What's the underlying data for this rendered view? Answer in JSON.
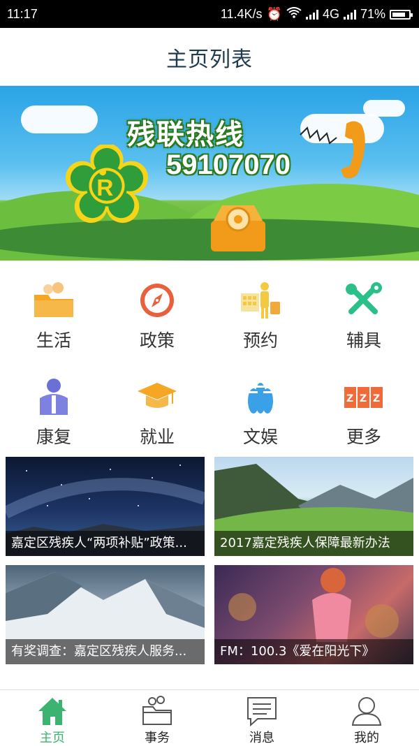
{
  "status_bar": {
    "time": "11:17",
    "speed": "11.4K/s",
    "network": "4G",
    "battery": "71%"
  },
  "header": {
    "title": "主页列表"
  },
  "banner": {
    "hotline_title": "残联热线",
    "hotline_number": "59107070"
  },
  "menu": [
    {
      "label": "生活",
      "icon": "folder-people-icon"
    },
    {
      "label": "政策",
      "icon": "compass-icon"
    },
    {
      "label": "预约",
      "icon": "calendar-person-icon"
    },
    {
      "label": "辅具",
      "icon": "tools-icon"
    },
    {
      "label": "康复",
      "icon": "person-icon"
    },
    {
      "label": "就业",
      "icon": "graduation-cap-icon"
    },
    {
      "label": "文娱",
      "icon": "bowling-icon"
    },
    {
      "label": "更多",
      "icon": "zzz-icon"
    }
  ],
  "news": [
    {
      "caption": "嘉定区残疾人“两项补贴”政策..."
    },
    {
      "caption": "2017嘉定残疾人保障最新办法"
    },
    {
      "caption": "有奖调查：嘉定区残疾人服务..."
    },
    {
      "caption": "FM：100.3《爱在阳光下》"
    }
  ],
  "tabs": [
    {
      "label": "主页",
      "icon": "home-icon",
      "active": true
    },
    {
      "label": "事务",
      "icon": "affairs-icon",
      "active": false
    },
    {
      "label": "消息",
      "icon": "message-icon",
      "active": false
    },
    {
      "label": "我的",
      "icon": "user-icon",
      "active": false
    }
  ],
  "colors": {
    "accent": "#3cb371",
    "title": "#1e3a4f",
    "orange": "#f39c1f"
  }
}
